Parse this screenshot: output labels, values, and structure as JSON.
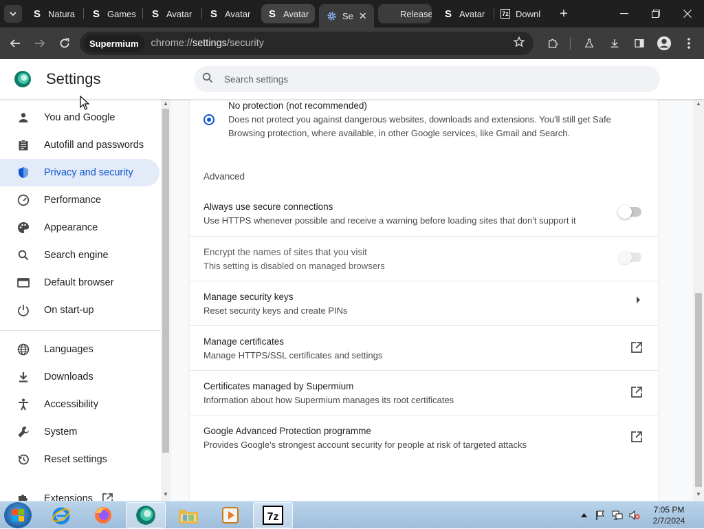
{
  "browser": {
    "tabs": [
      {
        "title": "Natura",
        "favicon": "S"
      },
      {
        "title": "Games",
        "favicon": "S"
      },
      {
        "title": "Avatar",
        "favicon": "S"
      },
      {
        "title": "Avatar",
        "favicon": "S"
      },
      {
        "title": "Avatar",
        "favicon": "S"
      },
      {
        "title": "Se",
        "favicon": "gear-icon",
        "active": true
      },
      {
        "title": "Release",
        "favicon": "none"
      },
      {
        "title": "Avatar",
        "favicon": "S"
      },
      {
        "title": "Downl",
        "favicon": "7z"
      }
    ],
    "omnibox": {
      "chip": "Supermium",
      "url_prefix": "chrome://",
      "url_host": "settings",
      "url_path": "/security"
    }
  },
  "settings": {
    "title": "Settings",
    "search_placeholder": "Search settings",
    "nav": [
      {
        "label": "You and Google",
        "icon": "person-icon"
      },
      {
        "label": "Autofill and passwords",
        "icon": "clipboard-icon"
      },
      {
        "label": "Privacy and security",
        "icon": "shield-icon",
        "active": true
      },
      {
        "label": "Performance",
        "icon": "speedometer-icon"
      },
      {
        "label": "Appearance",
        "icon": "palette-icon"
      },
      {
        "label": "Search engine",
        "icon": "search-icon"
      },
      {
        "label": "Default browser",
        "icon": "browser-icon"
      },
      {
        "label": "On start-up",
        "icon": "power-icon"
      },
      {
        "label": "Languages",
        "icon": "globe-icon"
      },
      {
        "label": "Downloads",
        "icon": "download-icon"
      },
      {
        "label": "Accessibility",
        "icon": "accessibility-icon"
      },
      {
        "label": "System",
        "icon": "wrench-icon"
      },
      {
        "label": "Reset settings",
        "icon": "history-icon"
      },
      {
        "label": "Extensions",
        "icon": "puzzle-icon"
      }
    ],
    "no_protection": {
      "title": "No protection (not recommended)",
      "description": "Does not protect you against dangerous websites, downloads and extensions. You'll still get Safe Browsing protection, where available, in other Google services, like Gmail and Search."
    },
    "advanced_heading": "Advanced",
    "rows": [
      {
        "title": "Always use secure connections",
        "desc": "Use HTTPS whenever possible and receive a warning before loading sites that don't support it",
        "control": "toggle-off"
      },
      {
        "title": "Encrypt the names of sites that you visit",
        "desc": "This setting is disabled on managed browsers",
        "control": "toggle-disabled"
      },
      {
        "title": "Manage security keys",
        "desc": "Reset security keys and create PINs",
        "control": "chevron-right-icon"
      },
      {
        "title": "Manage certificates",
        "desc": "Manage HTTPS/SSL certificates and settings",
        "control": "external-link-icon"
      },
      {
        "title": "Certificates managed by Supermium",
        "desc": "Information about how Supermium manages its root certificates",
        "control": "external-link-icon"
      },
      {
        "title": "Google Advanced Protection programme",
        "desc": "Provides Google's strongest account security for people at risk of targeted attacks",
        "control": "external-link-icon"
      }
    ]
  },
  "taskbar": {
    "apps": [
      "internet-explorer-icon",
      "firefox-icon",
      "supermium-icon",
      "file-explorer-icon",
      "media-player-icon",
      "7zip-icon"
    ],
    "time": "7:05 PM",
    "date": "2/7/2024"
  },
  "colors": {
    "accent": "#0b57d0",
    "active_nav_bg": "#e3eaf8",
    "tabstrip_bg": "#1f1f1f",
    "toolbar_bg": "#3c3c3c"
  }
}
